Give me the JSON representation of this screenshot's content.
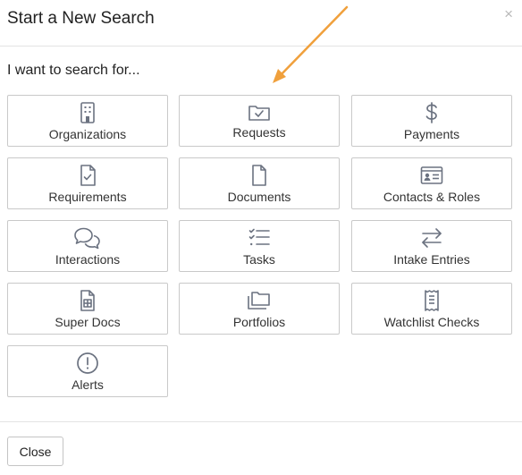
{
  "dialog": {
    "title": "Start a New Search",
    "close_symbol": "×",
    "prompt": "I want to search for..."
  },
  "tiles": [
    {
      "label": "Organizations",
      "icon": "building-icon"
    },
    {
      "label": "Requests",
      "icon": "folder-check-icon"
    },
    {
      "label": "Payments",
      "icon": "dollar-icon"
    },
    {
      "label": "Requirements",
      "icon": "file-check-icon"
    },
    {
      "label": "Documents",
      "icon": "document-icon"
    },
    {
      "label": "Contacts & Roles",
      "icon": "id-card-icon"
    },
    {
      "label": "Interactions",
      "icon": "chat-bubbles-icon"
    },
    {
      "label": "Tasks",
      "icon": "task-list-icon"
    },
    {
      "label": "Intake Entries",
      "icon": "arrows-exchange-icon"
    },
    {
      "label": "Super Docs",
      "icon": "spreadsheet-doc-icon"
    },
    {
      "label": "Portfolios",
      "icon": "folders-icon"
    },
    {
      "label": "Watchlist Checks",
      "icon": "receipt-icon"
    },
    {
      "label": "Alerts",
      "icon": "alert-circle-icon"
    }
  ],
  "footer": {
    "close_label": "Close"
  },
  "colors": {
    "icon": "#6b7280",
    "annotation_arrow": "#f0a03c",
    "border": "#c9c9c9"
  }
}
